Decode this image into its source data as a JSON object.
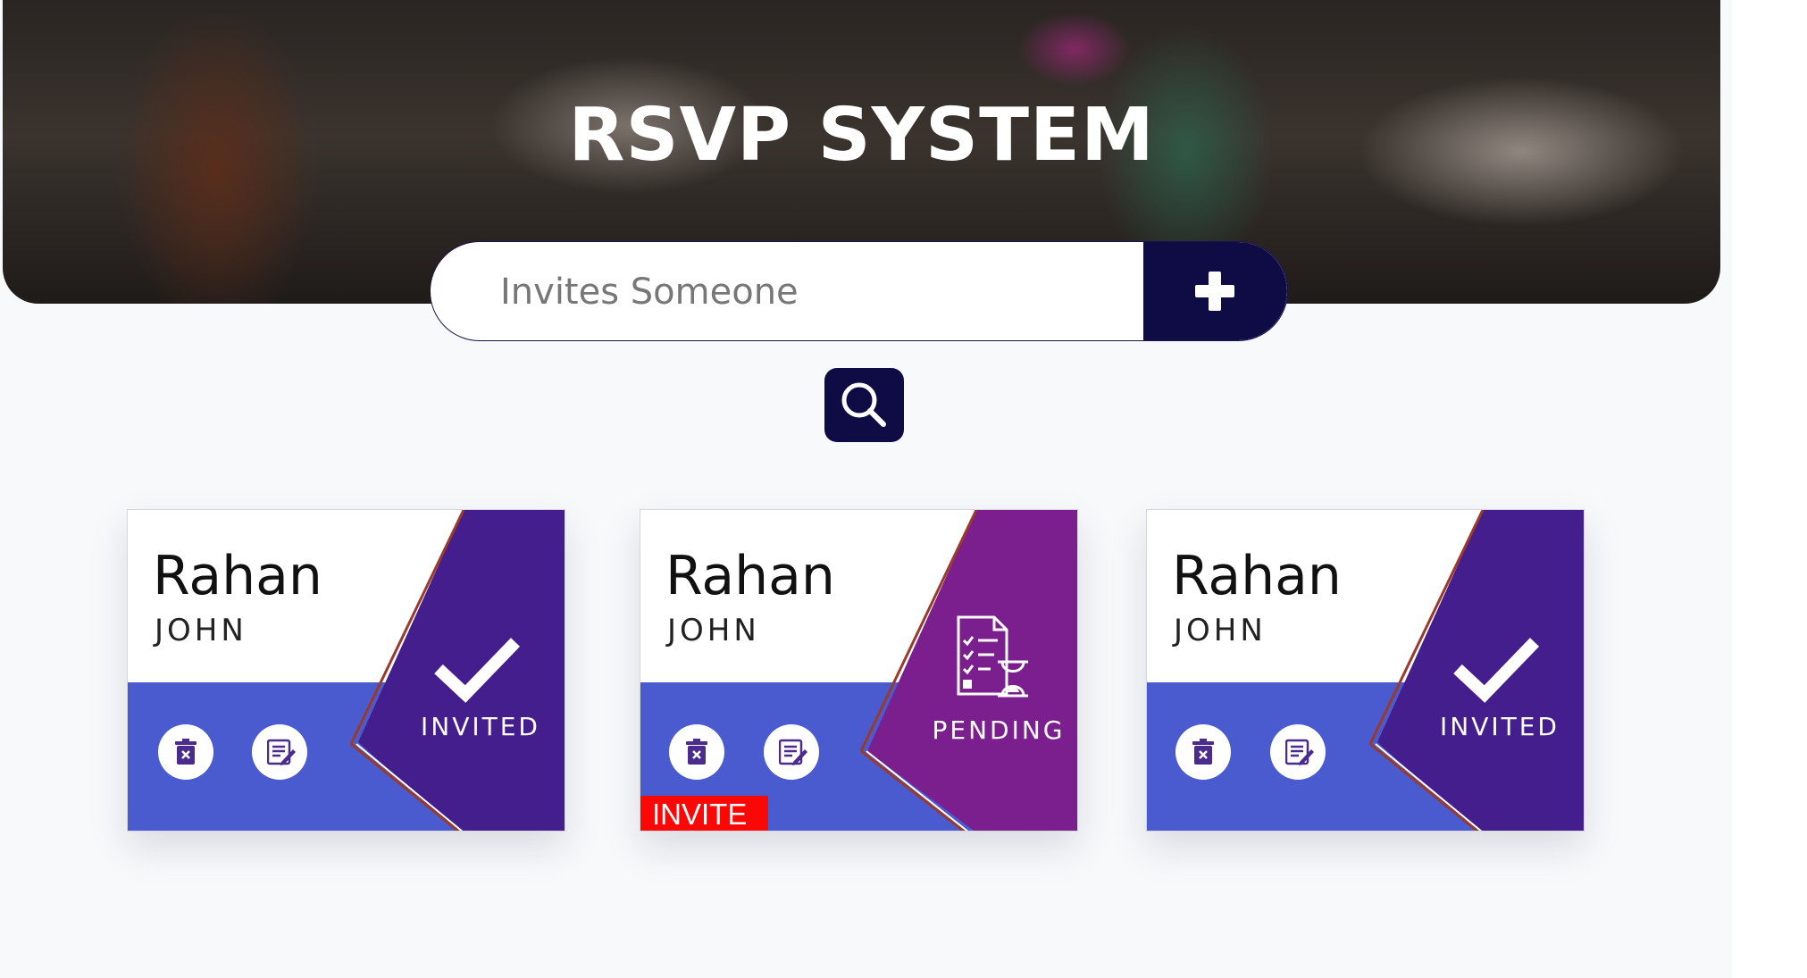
{
  "colors": {
    "navy": "#0f0b44",
    "card_band": "#4a5acf",
    "invited_panel": "#451e8e",
    "pending_panel": "#7b1e8e",
    "invite_tag": "#fb0706"
  },
  "header": {
    "title": "RSVP SYSTEM"
  },
  "invite": {
    "placeholder": "Invites Someone",
    "add_icon": "plus-icon"
  },
  "search": {
    "icon": "search-icon"
  },
  "cards": [
    {
      "first_name": "Rahan",
      "last_name": "JOHN",
      "status": "INVITED",
      "status_icon": "checkmark-icon",
      "actions": [
        "trash-icon",
        "edit-note-icon"
      ]
    },
    {
      "first_name": "Rahan",
      "last_name": "JOHN",
      "status": "PENDING",
      "status_icon": "checklist-hourglass-icon",
      "actions": [
        "trash-icon",
        "edit-note-icon"
      ],
      "badge": "INVITE"
    },
    {
      "first_name": "Rahan",
      "last_name": "JOHN",
      "status": "INVITED",
      "status_icon": "checkmark-icon",
      "actions": [
        "trash-icon",
        "edit-note-icon"
      ]
    }
  ]
}
